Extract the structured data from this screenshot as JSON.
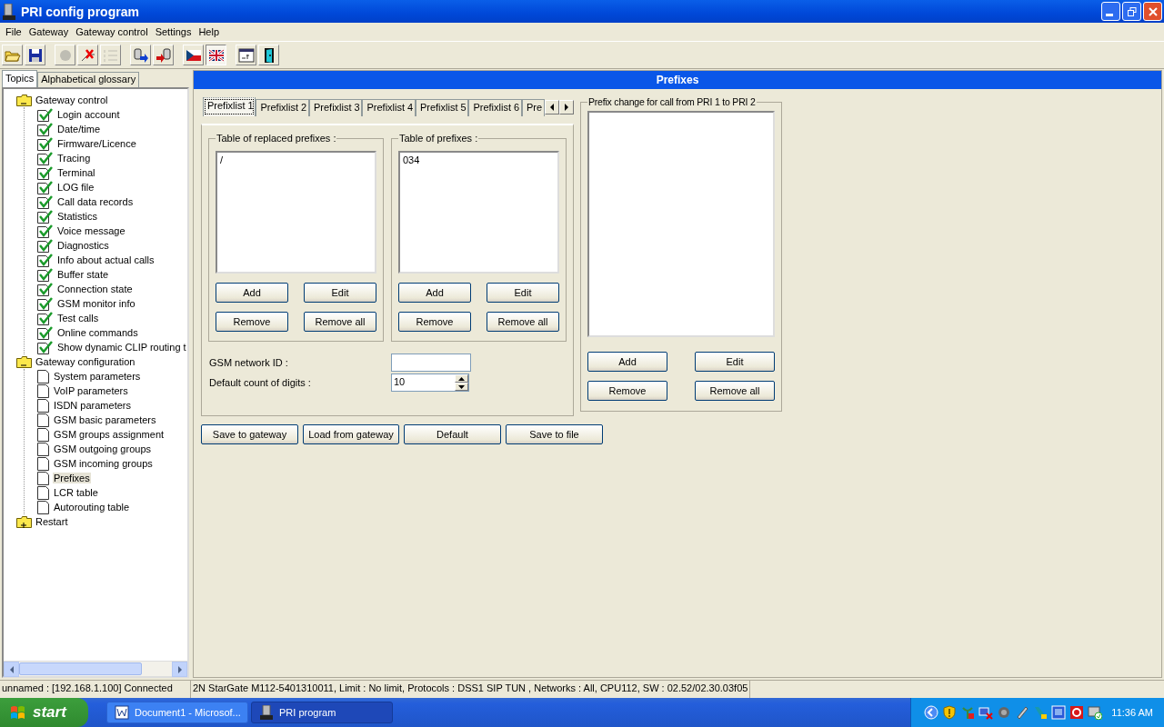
{
  "window": {
    "title": "PRI config program"
  },
  "menu": [
    "File",
    "Gateway",
    "Gateway control",
    "Settings",
    "Help"
  ],
  "toolbar": [
    {
      "kind": "open",
      "disabled": false,
      "pressed": false
    },
    {
      "kind": "save",
      "disabled": false,
      "pressed": false
    },
    {
      "kind": "record",
      "disabled": true,
      "pressed": false
    },
    {
      "kind": "disconnect",
      "disabled": false,
      "pressed": false
    },
    {
      "kind": "list",
      "disabled": true,
      "pressed": false
    },
    {
      "kind": "upload",
      "disabled": false,
      "pressed": false
    },
    {
      "kind": "download",
      "disabled": false,
      "pressed": false
    },
    {
      "kind": "flag-cz",
      "disabled": false,
      "pressed": false
    },
    {
      "kind": "flag-uk",
      "disabled": false,
      "pressed": true
    },
    {
      "kind": "terminal",
      "disabled": false,
      "pressed": false
    },
    {
      "kind": "exit",
      "disabled": false,
      "pressed": false
    }
  ],
  "sidebar": {
    "tabs": [
      {
        "label": "Topics",
        "selected": true
      },
      {
        "label": "Alphabetical glossary",
        "selected": false
      }
    ],
    "tree": [
      {
        "label": "Gateway control",
        "kind": "folder",
        "expanded": true,
        "selected": false,
        "children": [
          {
            "label": "Login account",
            "kind": "checked",
            "selected": false
          },
          {
            "label": "Date/time",
            "kind": "checked",
            "selected": false
          },
          {
            "label": "Firmware/Licence",
            "kind": "checked",
            "selected": false
          },
          {
            "label": "Tracing",
            "kind": "checked",
            "selected": false
          },
          {
            "label": "Terminal",
            "kind": "checked",
            "selected": false
          },
          {
            "label": "LOG file",
            "kind": "checked",
            "selected": false
          },
          {
            "label": "Call data records",
            "kind": "checked",
            "selected": false
          },
          {
            "label": "Statistics",
            "kind": "checked",
            "selected": false
          },
          {
            "label": "Voice message",
            "kind": "checked",
            "selected": false
          },
          {
            "label": "Diagnostics",
            "kind": "checked",
            "selected": false
          },
          {
            "label": "Info about actual calls",
            "kind": "checked",
            "selected": false
          },
          {
            "label": "Buffer state",
            "kind": "checked",
            "selected": false
          },
          {
            "label": "Connection state",
            "kind": "checked",
            "selected": false
          },
          {
            "label": "GSM monitor info",
            "kind": "checked",
            "selected": false
          },
          {
            "label": "Test calls",
            "kind": "checked",
            "selected": false
          },
          {
            "label": "Online commands",
            "kind": "checked",
            "selected": false
          },
          {
            "label": "Show dynamic CLIP routing t",
            "kind": "checked",
            "selected": false
          }
        ]
      },
      {
        "label": "Gateway configuration",
        "kind": "folder",
        "expanded": true,
        "selected": false,
        "children": [
          {
            "label": "System parameters",
            "kind": "page",
            "selected": false
          },
          {
            "label": "VoIP parameters",
            "kind": "page",
            "selected": false
          },
          {
            "label": "ISDN parameters",
            "kind": "page",
            "selected": false
          },
          {
            "label": "GSM basic parameters",
            "kind": "page",
            "selected": false
          },
          {
            "label": "GSM groups assignment",
            "kind": "page",
            "selected": false
          },
          {
            "label": "GSM outgoing groups",
            "kind": "page",
            "selected": false
          },
          {
            "label": "GSM incoming groups",
            "kind": "page",
            "selected": false
          },
          {
            "label": "Prefixes",
            "kind": "page",
            "selected": true
          },
          {
            "label": "LCR table",
            "kind": "page",
            "selected": false
          },
          {
            "label": "Autorouting table",
            "kind": "page",
            "selected": false
          }
        ]
      },
      {
        "label": "Restart",
        "kind": "folder",
        "expanded": false,
        "selected": false
      }
    ]
  },
  "main": {
    "header": "Prefixes",
    "tabs": [
      {
        "label": "Prefixlist 1",
        "selected": true
      },
      {
        "label": "Prefixlist 2",
        "selected": false
      },
      {
        "label": "Prefixlist 3",
        "selected": false
      },
      {
        "label": "Prefixlist 4",
        "selected": false
      },
      {
        "label": "Prefixlist 5",
        "selected": false
      },
      {
        "label": "Prefixlist 6",
        "selected": false
      },
      {
        "label": "Pre",
        "selected": false
      }
    ],
    "groups": [
      {
        "title": "Table of replaced prefixes :",
        "items": [
          "/"
        ],
        "buttons": [
          "Add",
          "Edit",
          "Remove",
          "Remove all"
        ]
      },
      {
        "title": "Table of  prefixes :",
        "items": [
          "034"
        ],
        "buttons": [
          "Add",
          "Edit",
          "Remove",
          "Remove all"
        ]
      }
    ],
    "fields": [
      {
        "label": "GSM network ID :",
        "kind": "text"
      },
      {
        "label": "Default count of digits :",
        "kind": "spin",
        "value": "10"
      }
    ],
    "side_group": {
      "title": "Prefix change for call from PRI 1 to PRI 2",
      "buttons": [
        "Add",
        "Edit",
        "Remove",
        "Remove all"
      ]
    },
    "actions": [
      "Save to gateway",
      "Load from gateway",
      "Default",
      "Save to file"
    ]
  },
  "status_bar": [
    "unnamed : [192.168.1.100] Connected",
    "2N StarGate M112-5401310011, Limit : No limit, Protocols : DSS1 SIP TUN , Networks : All, CPU112, SW : 02.52/02.30.03f05"
  ],
  "taskbar": {
    "start": "start",
    "tasks": [
      {
        "label": "Document1 - Microsof...",
        "kind": "word",
        "selected": false
      },
      {
        "label": "PRI program",
        "kind": "app",
        "selected": true
      }
    ],
    "clock": "11:36 AM"
  }
}
